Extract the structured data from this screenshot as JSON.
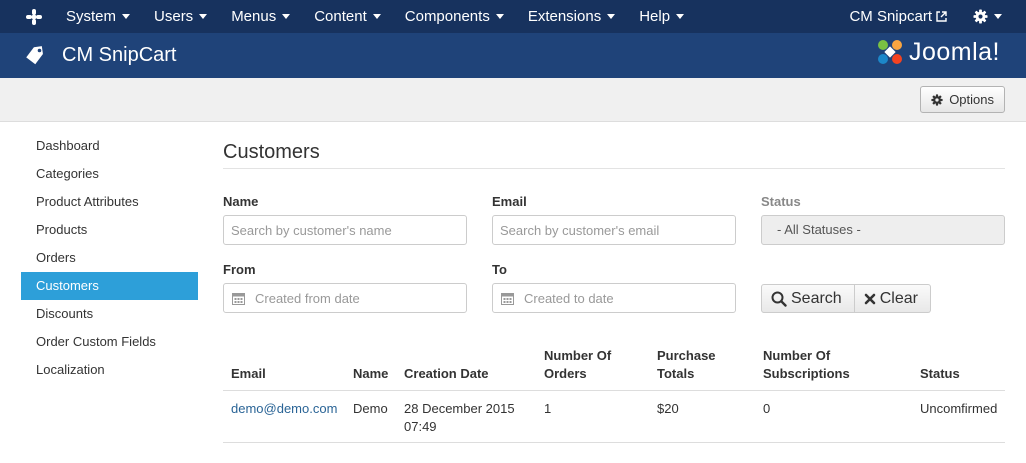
{
  "navbar": {
    "logo_icon": "joomla-icon",
    "menu": [
      "System",
      "Users",
      "Menus",
      "Content",
      "Components",
      "Extensions",
      "Help"
    ],
    "site_link": "CM Snipcart",
    "site_link_icon": "external-link-icon",
    "admin_icon": "gear-icon"
  },
  "header": {
    "icon": "tag-icon",
    "title": "CM SnipCart",
    "brand": "Joomla!"
  },
  "toolbar": {
    "options_label": "Options",
    "options_icon": "gear-icon"
  },
  "sidebar": {
    "items": [
      {
        "label": "Dashboard",
        "active": false
      },
      {
        "label": "Categories",
        "active": false
      },
      {
        "label": "Product Attributes",
        "active": false
      },
      {
        "label": "Products",
        "active": false
      },
      {
        "label": "Orders",
        "active": false
      },
      {
        "label": "Customers",
        "active": true
      },
      {
        "label": "Discounts",
        "active": false
      },
      {
        "label": "Order Custom Fields",
        "active": false
      },
      {
        "label": "Localization",
        "active": false
      }
    ],
    "active_color": "#2d9fd9"
  },
  "main": {
    "title": "Customers",
    "filters": {
      "name_label": "Name",
      "name_placeholder": "Search by customer's name",
      "email_label": "Email",
      "email_placeholder": "Search by customer's email",
      "status_label": "Status",
      "status_value": "- All Statuses -",
      "from_label": "From",
      "from_placeholder": "Created from date",
      "to_label": "To",
      "to_placeholder": "Created to date",
      "search_label": "Search",
      "clear_label": "Clear"
    },
    "table": {
      "headers": {
        "email": "Email",
        "name": "Name",
        "creation_date": "Creation Date",
        "orders": [
          "Number Of",
          "Orders"
        ],
        "purchase": [
          "Purchase",
          "Totals"
        ],
        "subscriptions": [
          "Number Of",
          "Subscriptions"
        ],
        "status": "Status"
      },
      "rows": [
        {
          "email": "demo@demo.com",
          "name": "Demo",
          "creation_date": [
            "28 December 2015",
            "07:49"
          ],
          "orders": "1",
          "purchase": "$20",
          "subscriptions": "0",
          "status": "Uncomfirmed"
        }
      ]
    }
  },
  "colors": {
    "navbar": "#17325e",
    "header": "#1f4379",
    "link": "#2a6496"
  }
}
